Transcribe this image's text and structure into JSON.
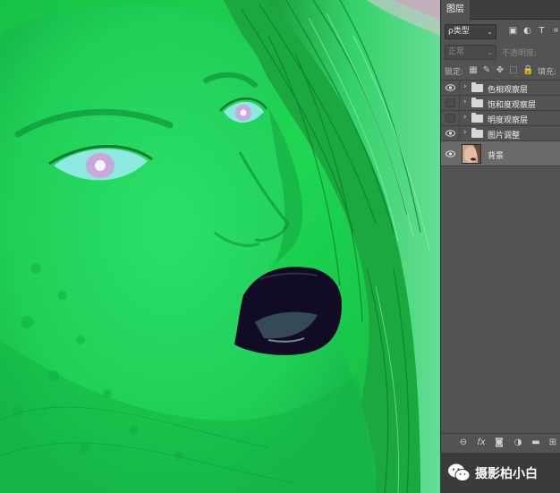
{
  "panel": {
    "tab_label": "图层",
    "filter": {
      "kind_label": "ρ类型",
      "icons": [
        "image-filter-icon",
        "adjustment-filter-icon",
        "type-filter-icon",
        "shape-filter-icon"
      ],
      "glyphs": [
        "▣",
        "◐",
        "T",
        "⌗"
      ]
    },
    "blend_mode": "正常",
    "opacity_label": "不透明度:",
    "lock_label": "锁定:",
    "lock_glyphs": [
      "▦",
      "✎",
      "✥",
      "⬚",
      "🔒"
    ],
    "fill_label": "填充:",
    "layers": [
      {
        "name": "色相观察层",
        "type": "group",
        "visible": true
      },
      {
        "name": "饱和度观察层",
        "type": "group",
        "visible": false
      },
      {
        "name": "明度观察层",
        "type": "group",
        "visible": false
      },
      {
        "name": "图片调整",
        "type": "group",
        "visible": true
      },
      {
        "name": "背景",
        "type": "pixel",
        "visible": true,
        "selected": true
      }
    ],
    "footer_glyphs": [
      "⊖",
      "fx",
      "◙",
      "◑",
      "▬",
      "⊞"
    ]
  },
  "watermark": {
    "text": "摄影柏小白"
  },
  "colors": {
    "panel_bg": "#535353",
    "panel_dark": "#3d3d3d",
    "canvas_green": "#19c94a",
    "selected_layer": "#6a6a6a"
  }
}
